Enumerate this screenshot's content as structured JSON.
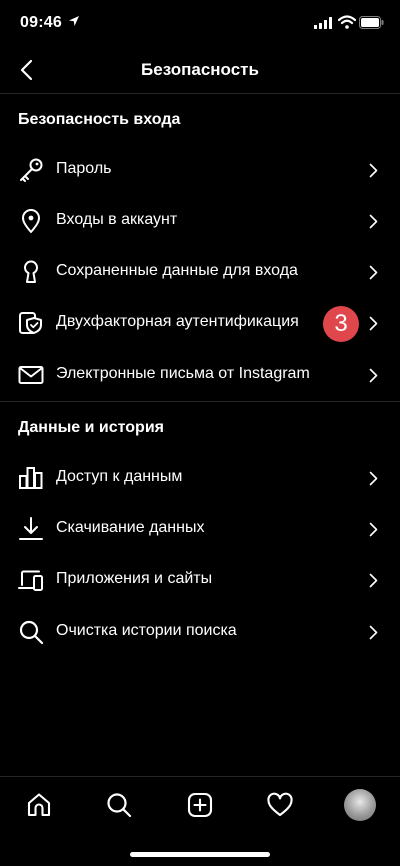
{
  "status_bar": {
    "time": "09:46"
  },
  "nav": {
    "title": "Безопасность"
  },
  "sections": [
    {
      "title": "Безопасность входа",
      "items": [
        {
          "label": "Пароль",
          "icon": "key-icon"
        },
        {
          "label": "Входы в аккаунт",
          "icon": "location-pin-icon"
        },
        {
          "label": "Сохраненные данные для входа",
          "icon": "keyhole-icon"
        },
        {
          "label": "Двухфакторная аутентификация",
          "icon": "shield-phone-icon",
          "badge": "3"
        },
        {
          "label": "Электронные письма от Instagram",
          "icon": "mail-icon"
        }
      ]
    },
    {
      "title": "Данные и история",
      "items": [
        {
          "label": "Доступ к данным",
          "icon": "bar-chart-icon"
        },
        {
          "label": "Скачивание данных",
          "icon": "download-icon"
        },
        {
          "label": "Приложения и сайты",
          "icon": "devices-icon"
        },
        {
          "label": "Очистка истории поиска",
          "icon": "search-icon"
        }
      ]
    }
  ],
  "tab_bar": {
    "tabs": [
      "home-icon",
      "search-icon",
      "add-post-icon",
      "activity-heart-icon",
      "profile-avatar"
    ]
  },
  "colors": {
    "background": "#000000",
    "text": "#ffffff",
    "badge": "#e0474c",
    "divider": "#262626"
  }
}
